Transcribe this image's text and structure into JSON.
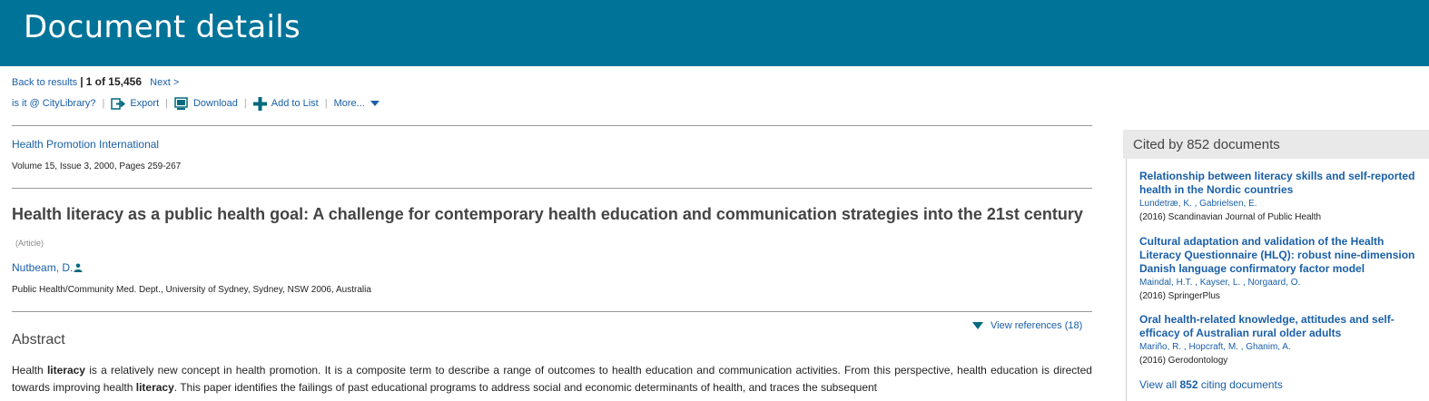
{
  "header": {
    "title": "Document details"
  },
  "nav": {
    "back": "Back to results",
    "sep": "|",
    "position": "1 of 15,456",
    "next": "Next >"
  },
  "toolbar": {
    "library": "is it @ CityLibrary?",
    "export": "Export",
    "download": "Download",
    "add_to_list": "Add to List",
    "more": "More..."
  },
  "document": {
    "journal": "Health Promotion International",
    "volume": "Volume 15, Issue 3, 2000, Pages 259-267",
    "title": "Health literacy as a public health goal: A challenge for contemporary health education and communication strategies into the 21st century",
    "type": "(Article)",
    "author": "Nutbeam, D.",
    "affiliation": "Public Health/Community Med. Dept., University of Sydney, Sydney, NSW 2006, Australia",
    "view_references": "View references (18)",
    "abstract_heading": "Abstract",
    "abstract_segments": [
      "Health ",
      "literacy",
      " is a relatively new concept in health promotion. It is a composite term to describe a range of outcomes to health education and communication activities. From this perspective, health education is directed towards improving health ",
      "literacy",
      ". This paper identifies the failings of past educational programs to address social and economic determinants of health, and traces the subsequent"
    ]
  },
  "cited_by": {
    "heading": "Cited by 852 documents",
    "items": [
      {
        "title": "Relationship between literacy skills and self-reported health in the Nordic countries",
        "authors": [
          "Lundetræ, K.",
          "Gabrielsen, E."
        ],
        "source": "(2016) Scandinavian Journal of Public Health"
      },
      {
        "title": "Cultural adaptation and validation of the Health Literacy Questionnaire (HLQ): robust nine-dimension Danish language confirmatory factor model",
        "authors": [
          "Maindal, H.T.",
          "Kayser, L.",
          "Norgaard, O."
        ],
        "source": "(2016) SpringerPlus"
      },
      {
        "title": "Oral health-related knowledge, attitudes and self-efficacy of Australian rural older adults",
        "authors": [
          "Mariño, R.",
          "Hopcraft, M.",
          "Ghanim, A."
        ],
        "source": "(2016) Gerodontology"
      }
    ],
    "view_all_prefix": "View all ",
    "view_all_count": "852",
    "view_all_suffix": " citing documents"
  },
  "colors": {
    "header_bg": "#007399",
    "link": "#1a5fa8",
    "teal_icon": "#006a80"
  },
  "icons": [
    "export-icon",
    "download-icon",
    "add-icon",
    "chevron-down-icon",
    "author-profile-icon",
    "triangle-down-icon"
  ]
}
